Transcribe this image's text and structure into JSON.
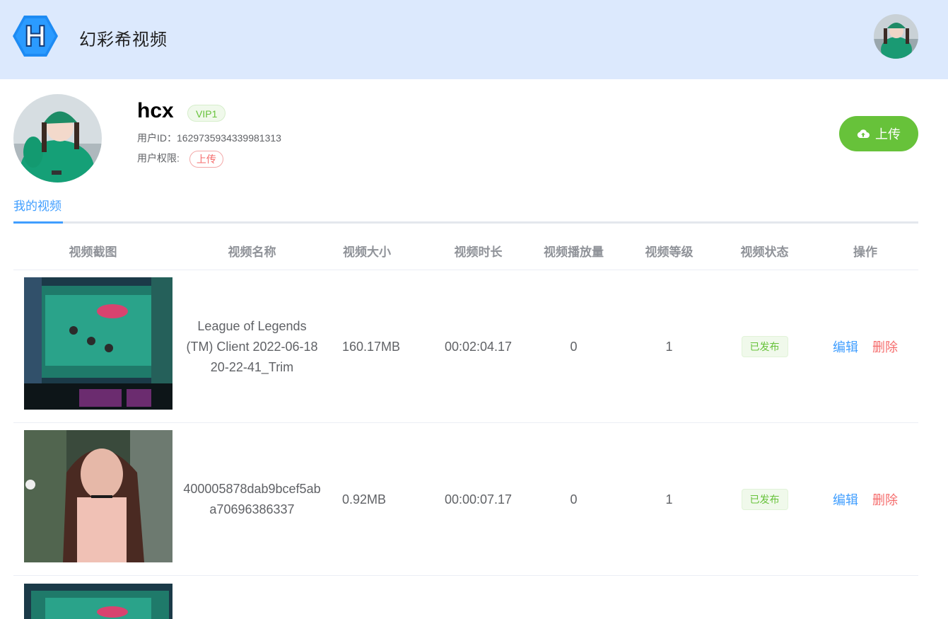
{
  "header": {
    "site_title": "幻彩希视频",
    "logo_letter": "H"
  },
  "profile": {
    "username": "hcx",
    "vip_label": "VIP1",
    "uid_label": "用户ID：",
    "uid_value": "1629735934339981313",
    "perm_label": "用户权限:",
    "perm_value": "上传",
    "upload_label": "上传"
  },
  "tabs": [
    {
      "label": "我的视频",
      "active": true
    }
  ],
  "table": {
    "headers": [
      "视频截图",
      "视频名称",
      "视频大小",
      "视频时长",
      "视频播放量",
      "视频等级",
      "视频状态",
      "操作"
    ],
    "rows": [
      {
        "name": "League of Legends (TM) Client 2022-06-18 20-22-41_Trim",
        "size": "160.17MB",
        "duration": "00:02:04.17",
        "plays": "0",
        "level": "1",
        "status": "已发布",
        "edit": "编辑",
        "delete": "删除"
      },
      {
        "name": "400005878dab9bcef5aba70696386337",
        "size": "0.92MB",
        "duration": "00:00:07.17",
        "plays": "0",
        "level": "1",
        "status": "已发布",
        "edit": "编辑",
        "delete": "删除"
      }
    ]
  },
  "colors": {
    "header_bg": "#dce9fd",
    "accent": "#409eff",
    "success": "#67c23a",
    "danger": "#f56c6c"
  }
}
